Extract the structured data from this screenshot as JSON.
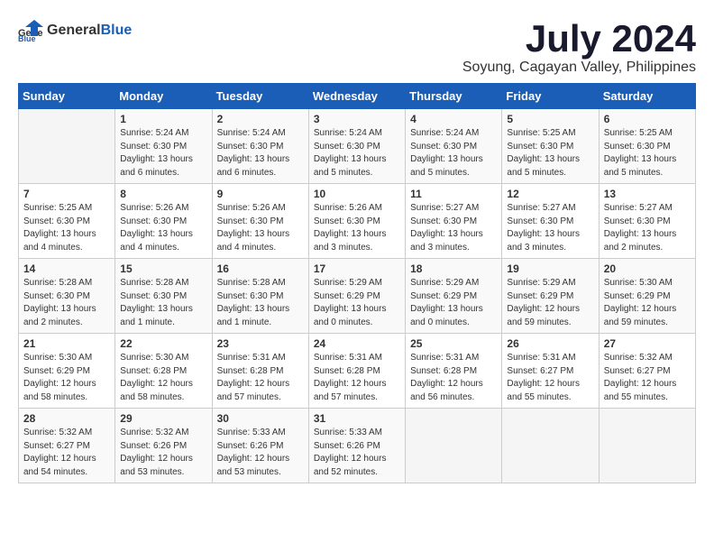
{
  "logo": {
    "general": "General",
    "blue": "Blue"
  },
  "title": "July 2024",
  "subtitle": "Soyung, Cagayan Valley, Philippines",
  "days_header": [
    "Sunday",
    "Monday",
    "Tuesday",
    "Wednesday",
    "Thursday",
    "Friday",
    "Saturday"
  ],
  "weeks": [
    [
      {
        "day": "",
        "info": ""
      },
      {
        "day": "1",
        "info": "Sunrise: 5:24 AM\nSunset: 6:30 PM\nDaylight: 13 hours\nand 6 minutes."
      },
      {
        "day": "2",
        "info": "Sunrise: 5:24 AM\nSunset: 6:30 PM\nDaylight: 13 hours\nand 6 minutes."
      },
      {
        "day": "3",
        "info": "Sunrise: 5:24 AM\nSunset: 6:30 PM\nDaylight: 13 hours\nand 5 minutes."
      },
      {
        "day": "4",
        "info": "Sunrise: 5:24 AM\nSunset: 6:30 PM\nDaylight: 13 hours\nand 5 minutes."
      },
      {
        "day": "5",
        "info": "Sunrise: 5:25 AM\nSunset: 6:30 PM\nDaylight: 13 hours\nand 5 minutes."
      },
      {
        "day": "6",
        "info": "Sunrise: 5:25 AM\nSunset: 6:30 PM\nDaylight: 13 hours\nand 5 minutes."
      }
    ],
    [
      {
        "day": "7",
        "info": "Sunrise: 5:25 AM\nSunset: 6:30 PM\nDaylight: 13 hours\nand 4 minutes."
      },
      {
        "day": "8",
        "info": "Sunrise: 5:26 AM\nSunset: 6:30 PM\nDaylight: 13 hours\nand 4 minutes."
      },
      {
        "day": "9",
        "info": "Sunrise: 5:26 AM\nSunset: 6:30 PM\nDaylight: 13 hours\nand 4 minutes."
      },
      {
        "day": "10",
        "info": "Sunrise: 5:26 AM\nSunset: 6:30 PM\nDaylight: 13 hours\nand 3 minutes."
      },
      {
        "day": "11",
        "info": "Sunrise: 5:27 AM\nSunset: 6:30 PM\nDaylight: 13 hours\nand 3 minutes."
      },
      {
        "day": "12",
        "info": "Sunrise: 5:27 AM\nSunset: 6:30 PM\nDaylight: 13 hours\nand 3 minutes."
      },
      {
        "day": "13",
        "info": "Sunrise: 5:27 AM\nSunset: 6:30 PM\nDaylight: 13 hours\nand 2 minutes."
      }
    ],
    [
      {
        "day": "14",
        "info": "Sunrise: 5:28 AM\nSunset: 6:30 PM\nDaylight: 13 hours\nand 2 minutes."
      },
      {
        "day": "15",
        "info": "Sunrise: 5:28 AM\nSunset: 6:30 PM\nDaylight: 13 hours\nand 1 minute."
      },
      {
        "day": "16",
        "info": "Sunrise: 5:28 AM\nSunset: 6:30 PM\nDaylight: 13 hours\nand 1 minute."
      },
      {
        "day": "17",
        "info": "Sunrise: 5:29 AM\nSunset: 6:29 PM\nDaylight: 13 hours\nand 0 minutes."
      },
      {
        "day": "18",
        "info": "Sunrise: 5:29 AM\nSunset: 6:29 PM\nDaylight: 13 hours\nand 0 minutes."
      },
      {
        "day": "19",
        "info": "Sunrise: 5:29 AM\nSunset: 6:29 PM\nDaylight: 12 hours\nand 59 minutes."
      },
      {
        "day": "20",
        "info": "Sunrise: 5:30 AM\nSunset: 6:29 PM\nDaylight: 12 hours\nand 59 minutes."
      }
    ],
    [
      {
        "day": "21",
        "info": "Sunrise: 5:30 AM\nSunset: 6:29 PM\nDaylight: 12 hours\nand 58 minutes."
      },
      {
        "day": "22",
        "info": "Sunrise: 5:30 AM\nSunset: 6:28 PM\nDaylight: 12 hours\nand 58 minutes."
      },
      {
        "day": "23",
        "info": "Sunrise: 5:31 AM\nSunset: 6:28 PM\nDaylight: 12 hours\nand 57 minutes."
      },
      {
        "day": "24",
        "info": "Sunrise: 5:31 AM\nSunset: 6:28 PM\nDaylight: 12 hours\nand 57 minutes."
      },
      {
        "day": "25",
        "info": "Sunrise: 5:31 AM\nSunset: 6:28 PM\nDaylight: 12 hours\nand 56 minutes."
      },
      {
        "day": "26",
        "info": "Sunrise: 5:31 AM\nSunset: 6:27 PM\nDaylight: 12 hours\nand 55 minutes."
      },
      {
        "day": "27",
        "info": "Sunrise: 5:32 AM\nSunset: 6:27 PM\nDaylight: 12 hours\nand 55 minutes."
      }
    ],
    [
      {
        "day": "28",
        "info": "Sunrise: 5:32 AM\nSunset: 6:27 PM\nDaylight: 12 hours\nand 54 minutes."
      },
      {
        "day": "29",
        "info": "Sunrise: 5:32 AM\nSunset: 6:26 PM\nDaylight: 12 hours\nand 53 minutes."
      },
      {
        "day": "30",
        "info": "Sunrise: 5:33 AM\nSunset: 6:26 PM\nDaylight: 12 hours\nand 53 minutes."
      },
      {
        "day": "31",
        "info": "Sunrise: 5:33 AM\nSunset: 6:26 PM\nDaylight: 12 hours\nand 52 minutes."
      },
      {
        "day": "",
        "info": ""
      },
      {
        "day": "",
        "info": ""
      },
      {
        "day": "",
        "info": ""
      }
    ]
  ]
}
